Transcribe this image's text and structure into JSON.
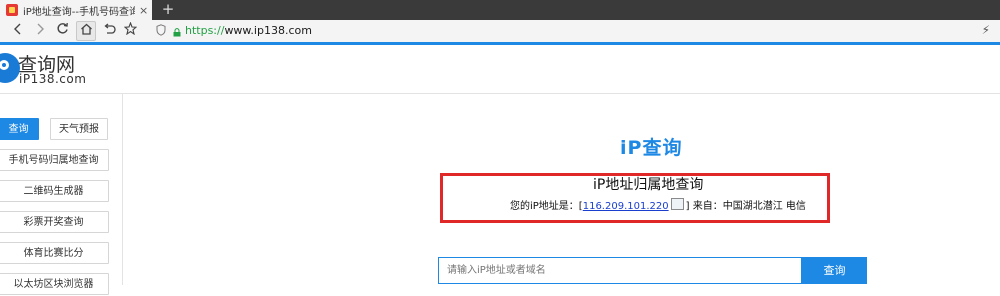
{
  "browser": {
    "tab_title": "iP地址查询--手机号码查询归属",
    "tab_close": "×",
    "new_tab": "+",
    "url_protocol": "https://",
    "url_host": "www.ip138.com"
  },
  "toolbar_icons": [
    "back-arrow-icon",
    "forward-arrow-icon",
    "reload-icon",
    "home-icon",
    "undo-icon",
    "star-icon"
  ],
  "accent_color": "#1e88e5",
  "site": {
    "logo_title": "查询网",
    "logo_sub": "iP138.com"
  },
  "sidebar": {
    "items": [
      {
        "label": "查询",
        "active": true
      },
      {
        "label": "天气预报",
        "active": false
      },
      {
        "label": "手机号码归属地查询",
        "active": false
      },
      {
        "label": "二维码生成器",
        "active": false
      },
      {
        "label": "彩票开奖查询",
        "active": false
      },
      {
        "label": "体育比赛比分",
        "active": false
      },
      {
        "label": "以太坊区块浏览器",
        "active": false
      }
    ]
  },
  "main": {
    "heading": "iP查询",
    "sub_title": "iP地址归属地查询",
    "ip_prefix": "您的iP地址是：[",
    "ip_address": "116.209.101.220",
    "ip_suffix": "] 来自：中国湖北潜江 电信",
    "search_placeholder": "请输入iP地址或者域名",
    "search_button": "查询"
  }
}
